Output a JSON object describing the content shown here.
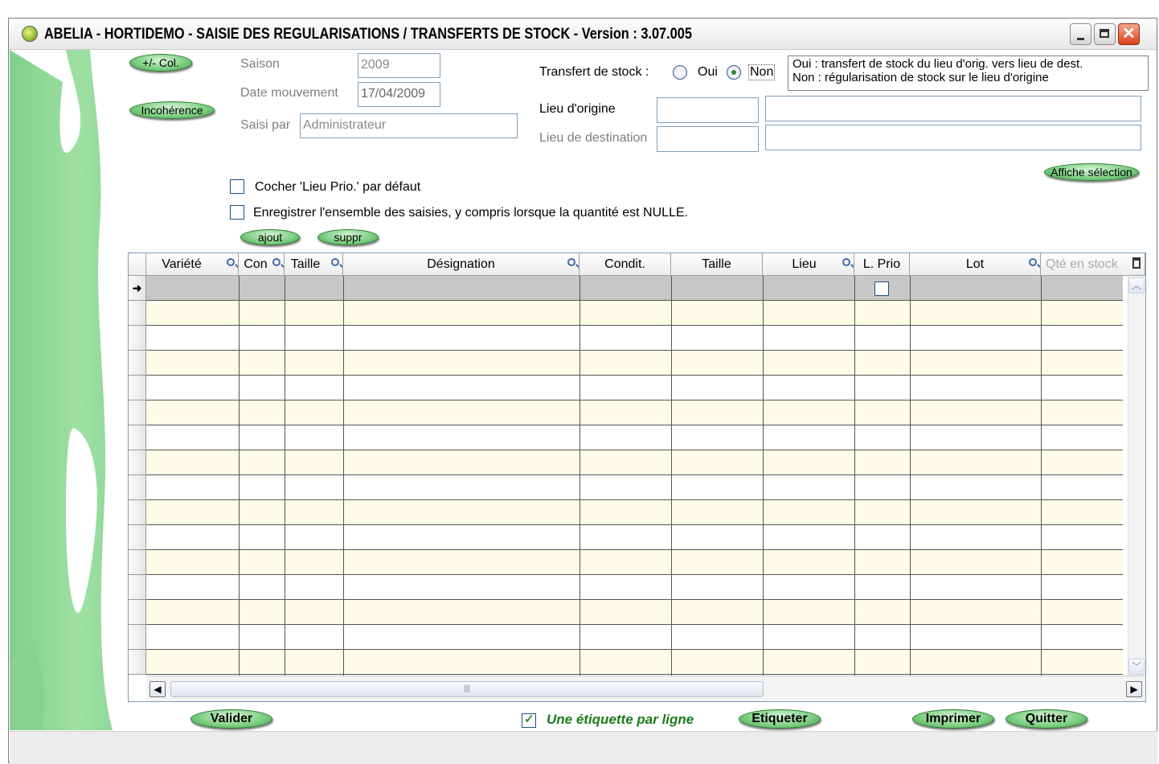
{
  "window": {
    "title": "ABELIA  -  HORTIDEMO  -  SAISIE DES REGULARISATIONS / TRANSFERTS  DE STOCK  -  Version : 3.07.005",
    "min_glyph": "",
    "close_glyph": "✕"
  },
  "left_buttons": {
    "col": "+/- Col.",
    "incoherence": "Incohérence"
  },
  "form": {
    "saison_label": "Saison",
    "saison_value": "2009",
    "date_label": "Date mouvement",
    "date_value": "17/04/2009",
    "saisi_label": "Saisi par",
    "saisi_value": "Administrateur",
    "transfert_label": "Transfert de stock :",
    "oui": "Oui",
    "non": "Non",
    "info_line1": "Oui : transfert de stock du lieu d'orig. vers lieu de dest.",
    "info_line2": "Non : régularisation de stock sur le lieu d'origine",
    "origine_label": "Lieu d'origine",
    "destination_label": "Lieu de destination",
    "affiche": "Affiche sélection",
    "cocher_label": "Cocher 'Lieu Prio.' par défaut",
    "enregistrer_label": "Enregistrer l'ensemble des saisies, y compris lorsque la quantité est NULLE.",
    "ajout": "ajout",
    "suppr": "suppr"
  },
  "grid": {
    "columns": [
      "Variété",
      "Con",
      "Taille",
      "Désignation",
      "Condit.",
      "Taille",
      "Lieu",
      "L. Prio",
      "Lot",
      "Qté en stock"
    ],
    "row_count": 16,
    "current_row_marker": "➜",
    "scroll_up": "︿",
    "scroll_down": "﹀",
    "scroll_left": "◀",
    "scroll_right": "▶",
    "thumb_grip": "|||"
  },
  "bottom": {
    "valider": "Valider",
    "etiquette_label": "Une étiquette par ligne",
    "etiqueter": "Etiqueter",
    "imprimer": "Imprimer",
    "quitter": "Quitter"
  }
}
